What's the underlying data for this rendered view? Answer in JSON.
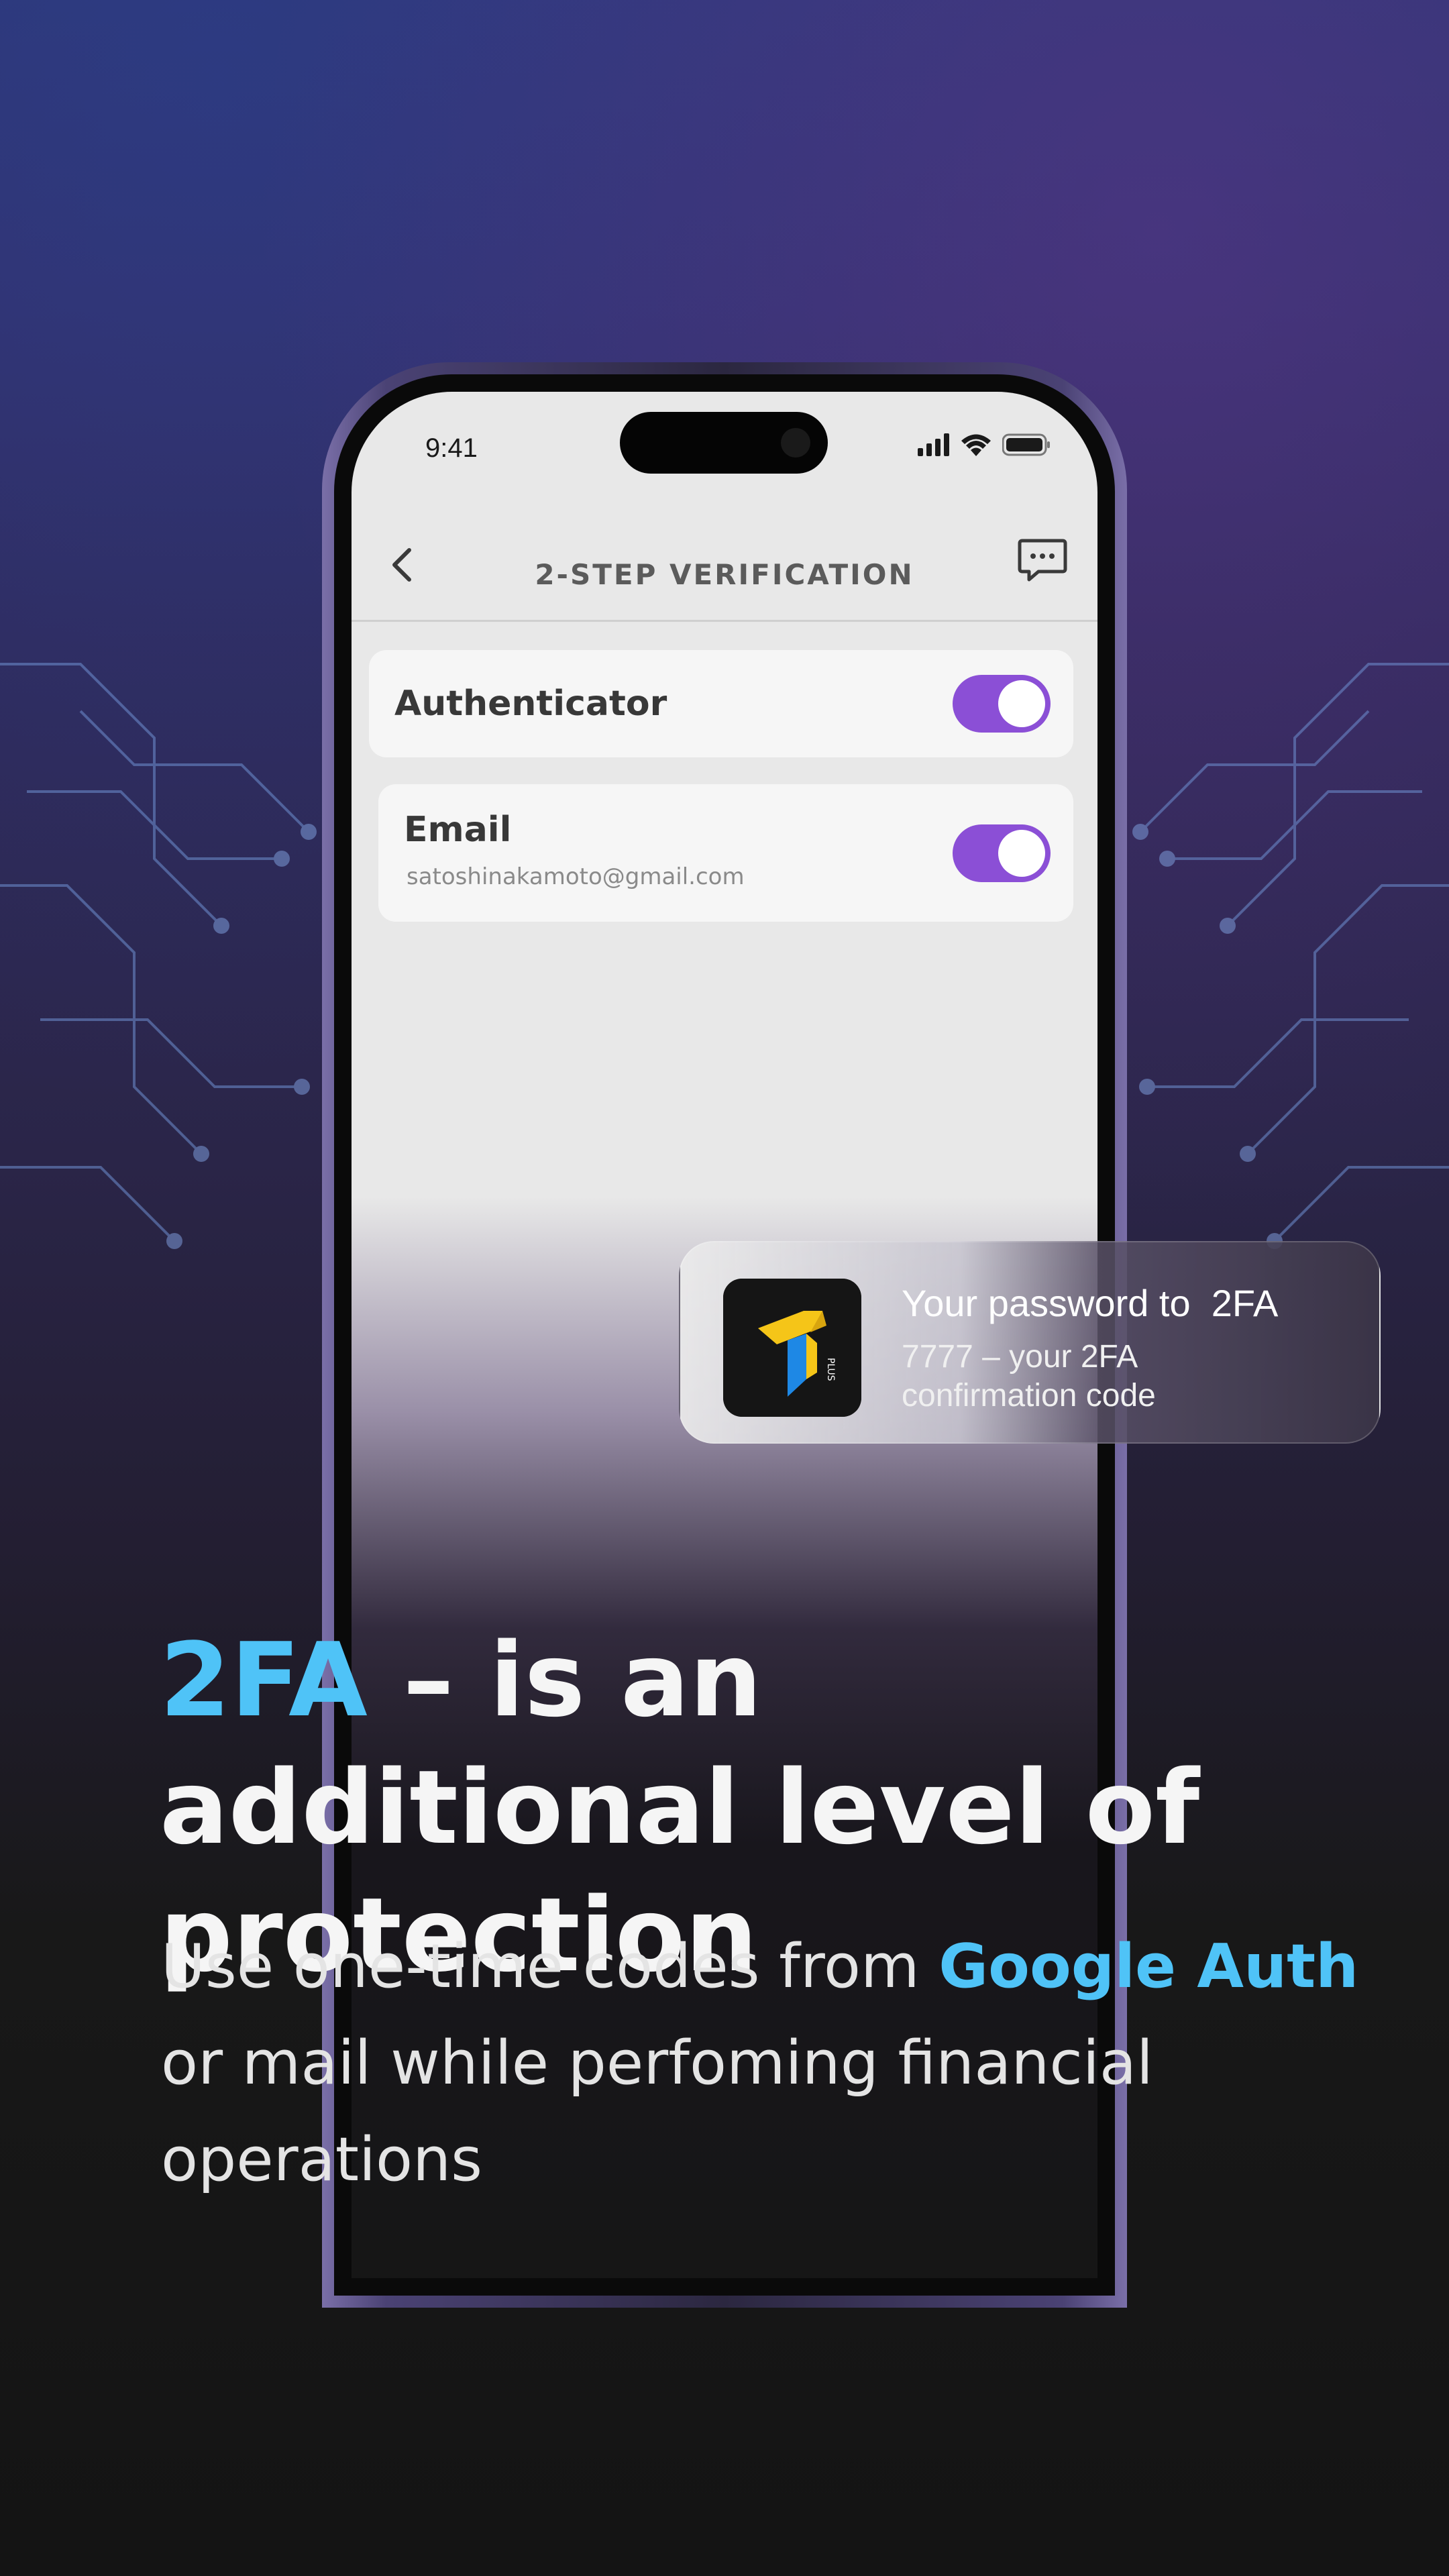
{
  "status_bar": {
    "time": "9:41"
  },
  "nav": {
    "title": "2-STEP VERIFICATION"
  },
  "settings": {
    "authenticator": {
      "label": "Authenticator",
      "enabled": true
    },
    "email": {
      "label": "Email",
      "address": "satoshinakamoto@gmail.com",
      "enabled": true
    }
  },
  "notification": {
    "title": "Your password to  2FA",
    "body": "7777 – your 2FA confirmation code",
    "icon": "t-plus-app-icon",
    "icon_text": "PLUS"
  },
  "headline": {
    "accent": "2FA",
    "rest": " – is an additional level of protection"
  },
  "subtext": {
    "part1": "Use one-time codes from ",
    "accent": "Google Auth",
    "part2": " or mail while perfoming financial operations"
  },
  "colors": {
    "accent": "#4fc3f7",
    "toggle": "#8b4fd6"
  }
}
